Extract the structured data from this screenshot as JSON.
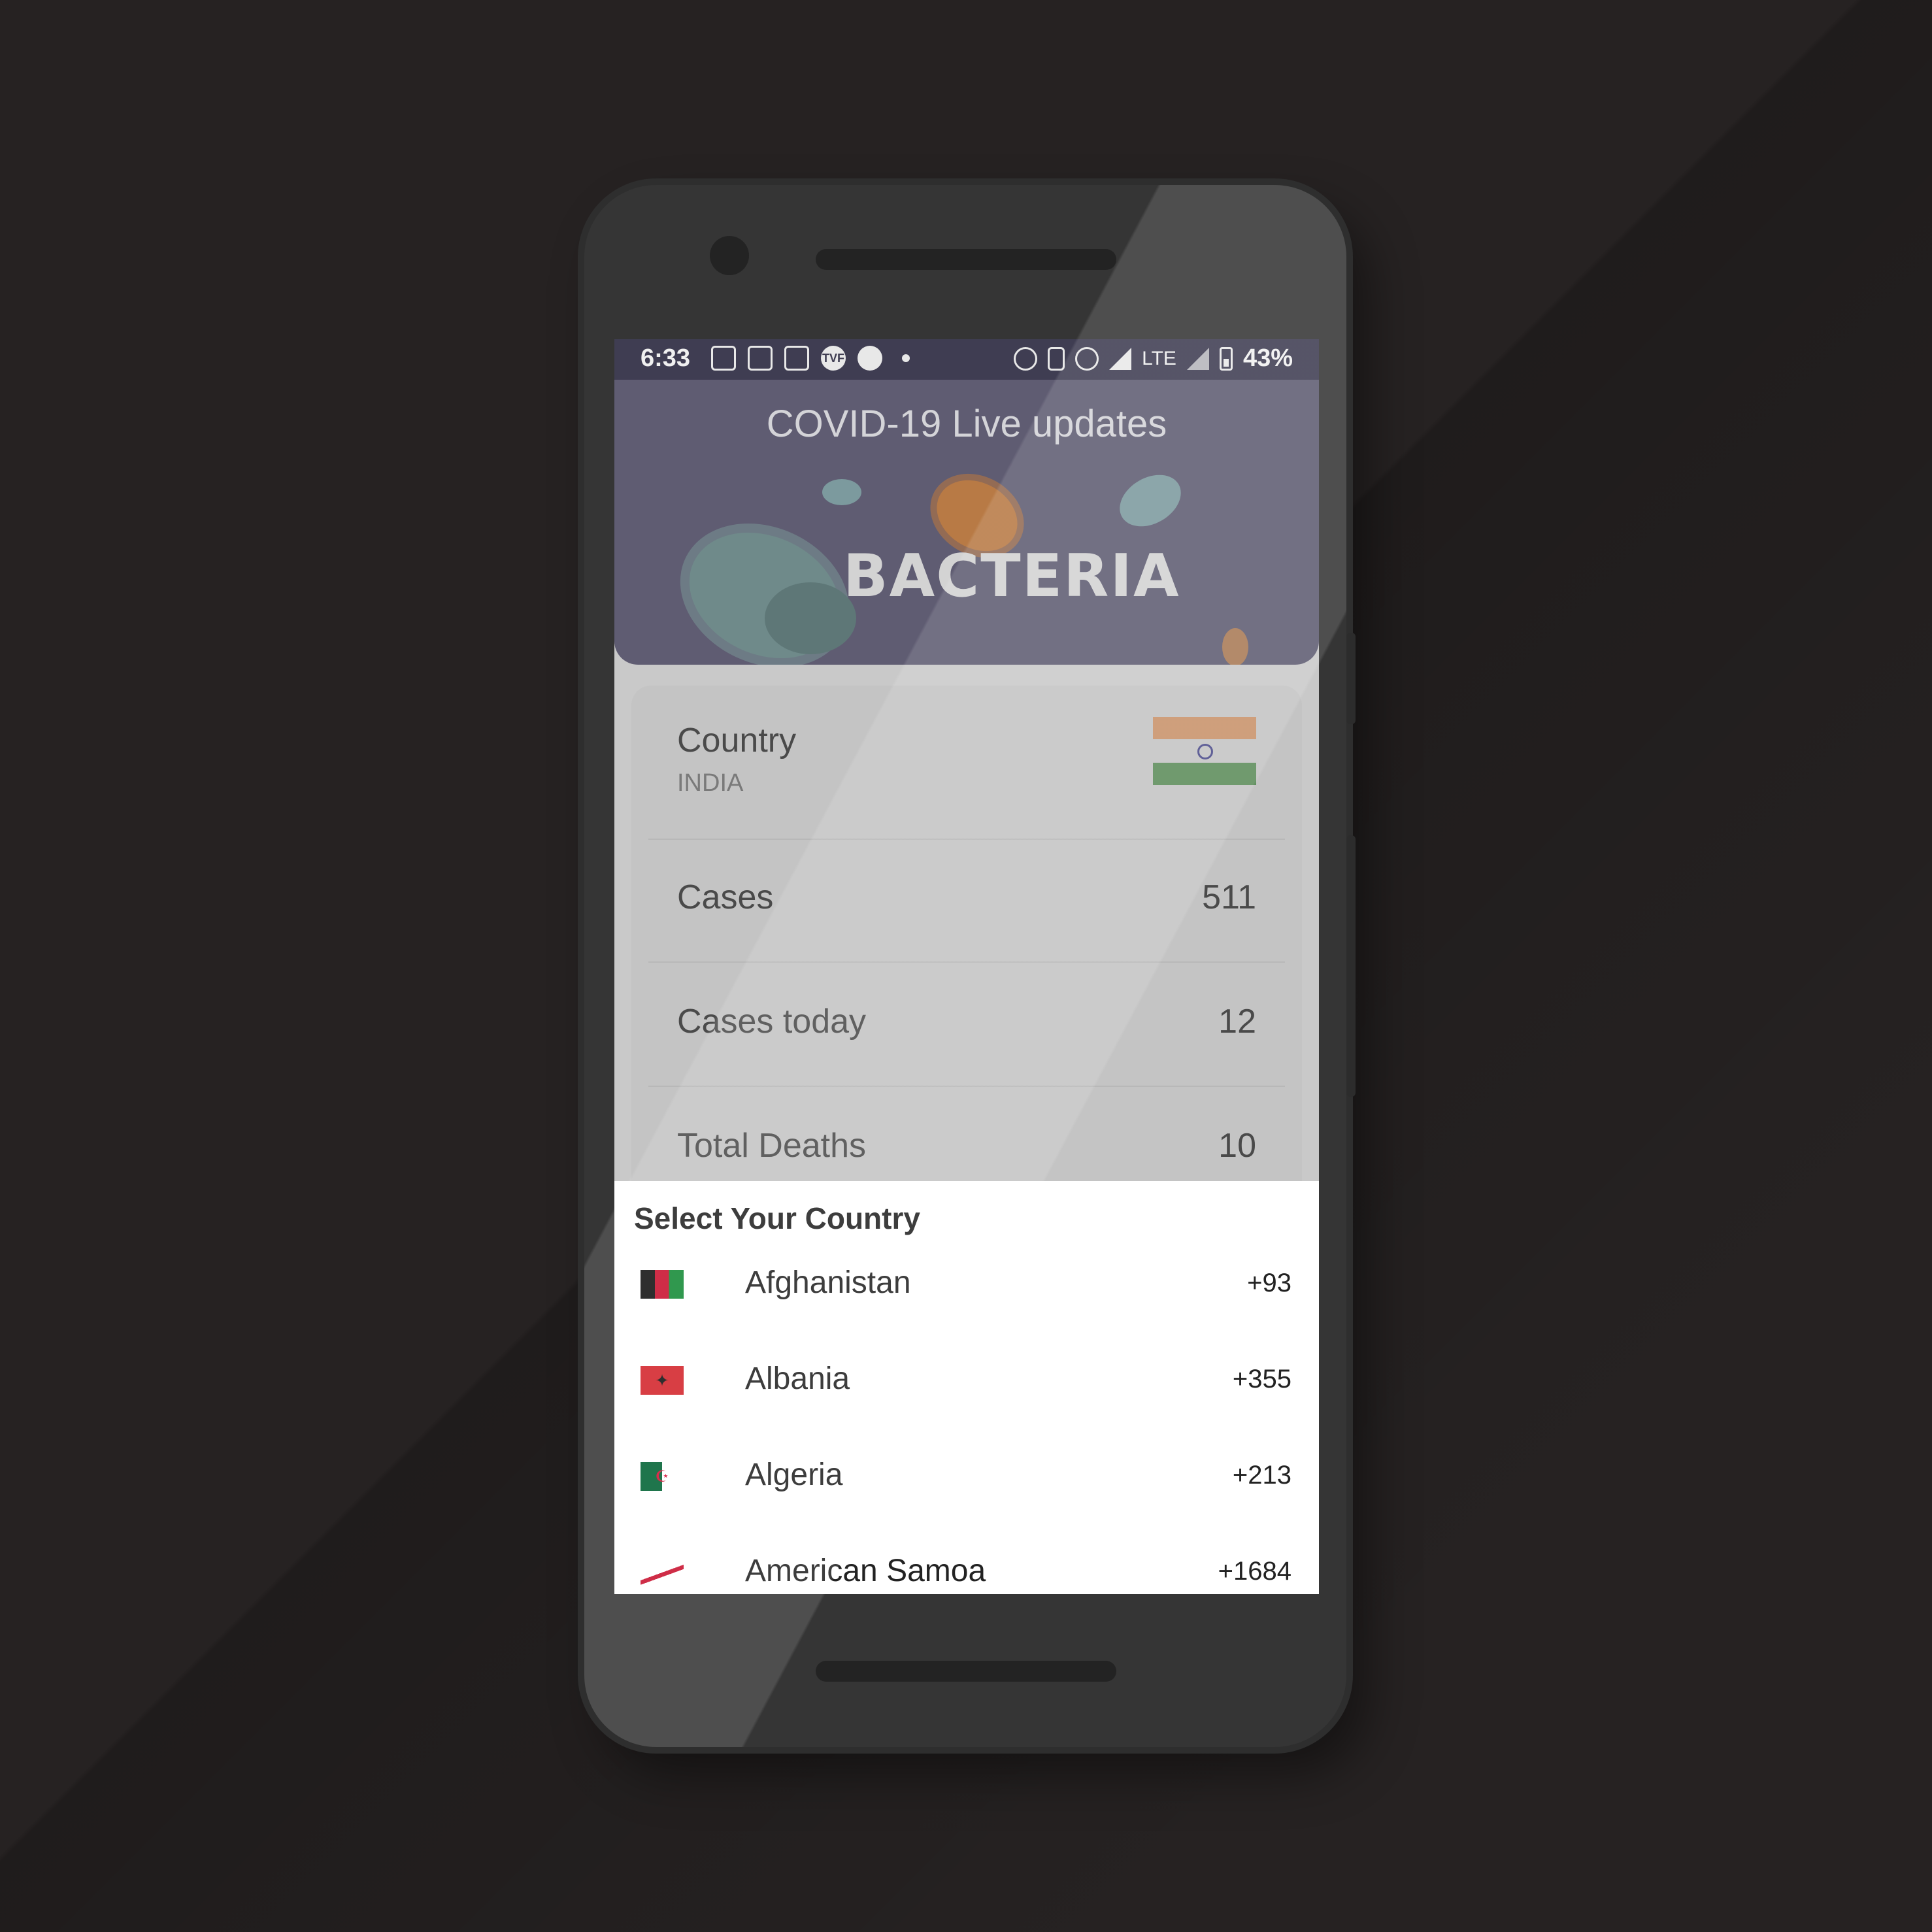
{
  "status_bar": {
    "time": "6:33",
    "left_icons": [
      "slack-icon",
      "calendar-icon",
      "calendar-icon",
      "tvf-icon",
      "reddit-icon",
      "dot-icon"
    ],
    "tvf_label": "TVF",
    "right_icons": [
      "alarm-icon",
      "vibrate-icon",
      "dnd-icon",
      "signal-icon",
      "lte-icon",
      "signal-icon",
      "battery-icon"
    ],
    "network": "LTE",
    "battery": "43%"
  },
  "header": {
    "title": "COVID-19 Live updates",
    "banner_text": "BACTERIA"
  },
  "stats": {
    "country_label": "Country",
    "country_value": "INDIA",
    "rows": [
      {
        "label": "Cases",
        "value": "511"
      },
      {
        "label": "Cases today",
        "value": "12"
      },
      {
        "label": "Total Deaths",
        "value": "10"
      }
    ]
  },
  "country_picker": {
    "title": "Select Your Country",
    "items": [
      {
        "name": "Afghanistan",
        "code": "+93",
        "flag_icon": "afghanistan-flag-icon"
      },
      {
        "name": "Albania",
        "code": "+355",
        "flag_icon": "albania-flag-icon"
      },
      {
        "name": "Algeria",
        "code": "+213",
        "flag_icon": "algeria-flag-icon"
      },
      {
        "name": "American Samoa",
        "code": "+1684",
        "flag_icon": "american-samoa-flag-icon"
      }
    ]
  },
  "colors": {
    "background": "#262222",
    "header": "#5f5c72",
    "status_bar": "#3f3d52",
    "sheet": "#ffffff"
  }
}
